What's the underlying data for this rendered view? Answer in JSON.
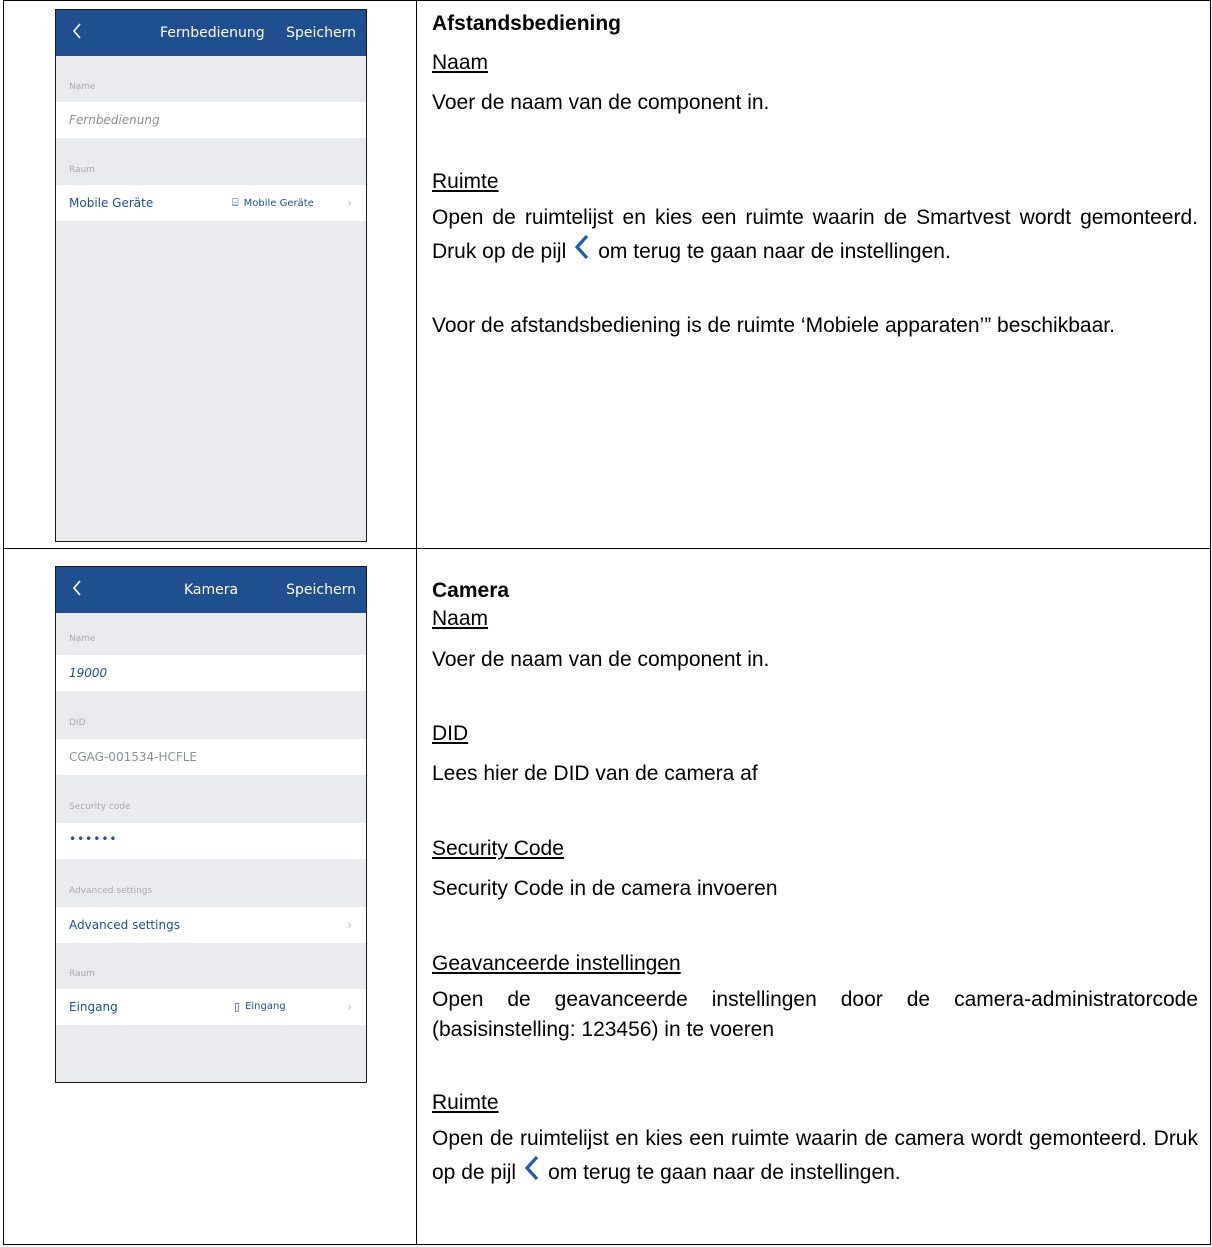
{
  "row1": {
    "phone": {
      "title": "Fernbedienung",
      "save": "Speichern",
      "name_label": "Name",
      "name_value": "Fernbedienung",
      "room_label": "Raum",
      "room_row_label": "Mobile Geräte",
      "room_row_value": "Mobile Geräte",
      "room_icon": "⌸"
    },
    "heading": "Afstandsbediening",
    "naam_title": "Naam",
    "naam_text": "Voer de naam van de component in.",
    "ruimte_title": "Ruimte",
    "ruimte_text_a": "Open de ruimtelijst en kies een ruimte waarin de Smartvest wordt gemonteerd. Druk op de pijl",
    "ruimte_text_b": "om terug te gaan naar de instellingen.",
    "ruimte_text_c": "Voor de afstandsbediening is de ruimte ‘Mobiele apparaten’” beschikbaar."
  },
  "row2": {
    "phone": {
      "title": "Kamera",
      "save": "Speichern",
      "name_label": "Name",
      "name_value": "19000",
      "did_label": "DID",
      "did_value": "CGAG-001534-HCFLE",
      "sec_label": "Security code",
      "sec_value": "••••••",
      "adv_label": "Advanced settings",
      "adv_row": "Advanced settings",
      "room_label": "Raum",
      "room_row_label": "Eingang",
      "room_row_value": "Eingang",
      "room_icon": "▯"
    },
    "heading": "Camera",
    "naam_title": "Naam",
    "naam_text": "Voer de naam van de component in.",
    "did_title": "DID",
    "did_text": "Lees hier de DID van de camera af",
    "sec_title": "Security Code",
    "sec_text": "Security Code in de camera invoeren",
    "adv_title": "Geavanceerde instellingen",
    "adv_text": "Open de geavanceerde instellingen door de camera-administratorcode (basisinstelling: 123456) in te voeren",
    "ruimte_title": "Ruimte",
    "ruimte_text_a": "Open de ruimtelijst en kies een ruimte waarin de camera wordt gemonteerd. Druk op de pijl",
    "ruimte_text_b": "om terug te gaan naar de instellingen."
  },
  "colors": {
    "primary": "#1f4f8f",
    "bg": "#e9ebef"
  }
}
